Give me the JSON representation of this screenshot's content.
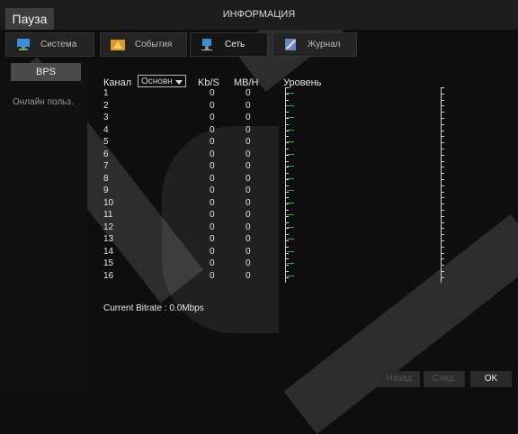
{
  "titlebar": {
    "pause_label": "Пауза",
    "title": "ИНФОРМАЦИЯ"
  },
  "tabs": [
    {
      "label": "Система",
      "icon": "monitor-icon"
    },
    {
      "label": "События",
      "icon": "warning-icon"
    },
    {
      "label": "Сеть",
      "icon": "network-icon"
    },
    {
      "label": "Журнал",
      "icon": "journal-icon"
    }
  ],
  "sidebar": {
    "bps_label": "BPS",
    "online_users_label": "Онлайн польз."
  },
  "table": {
    "channel_header": "Канал",
    "stream_select": "Основн",
    "kbs_header": "Kb/S",
    "mbh_header": "MB/H",
    "level_header": "Уровень",
    "rows": [
      {
        "channel": "1",
        "kbs": "0",
        "mbh": "0"
      },
      {
        "channel": "2",
        "kbs": "0",
        "mbh": "0"
      },
      {
        "channel": "3",
        "kbs": "0",
        "mbh": "0"
      },
      {
        "channel": "4",
        "kbs": "0",
        "mbh": "0"
      },
      {
        "channel": "5",
        "kbs": "0",
        "mbh": "0"
      },
      {
        "channel": "6",
        "kbs": "0",
        "mbh": "0"
      },
      {
        "channel": "7",
        "kbs": "0",
        "mbh": "0"
      },
      {
        "channel": "8",
        "kbs": "0",
        "mbh": "0"
      },
      {
        "channel": "9",
        "kbs": "0",
        "mbh": "0"
      },
      {
        "channel": "10",
        "kbs": "0",
        "mbh": "0"
      },
      {
        "channel": "11",
        "kbs": "0",
        "mbh": "0"
      },
      {
        "channel": "12",
        "kbs": "0",
        "mbh": "0"
      },
      {
        "channel": "13",
        "kbs": "0",
        "mbh": "0"
      },
      {
        "channel": "14",
        "kbs": "0",
        "mbh": "0"
      },
      {
        "channel": "15",
        "kbs": "0",
        "mbh": "0"
      },
      {
        "channel": "16",
        "kbs": "0",
        "mbh": "0"
      }
    ]
  },
  "current_bitrate": "Current Bitrate : 0.0Mbps",
  "buttons": {
    "back": "Назад",
    "next": "След.",
    "ok": "OK"
  },
  "colors": {
    "level_indicator": "#3aa44a",
    "active_button": "#4a4a4a"
  }
}
